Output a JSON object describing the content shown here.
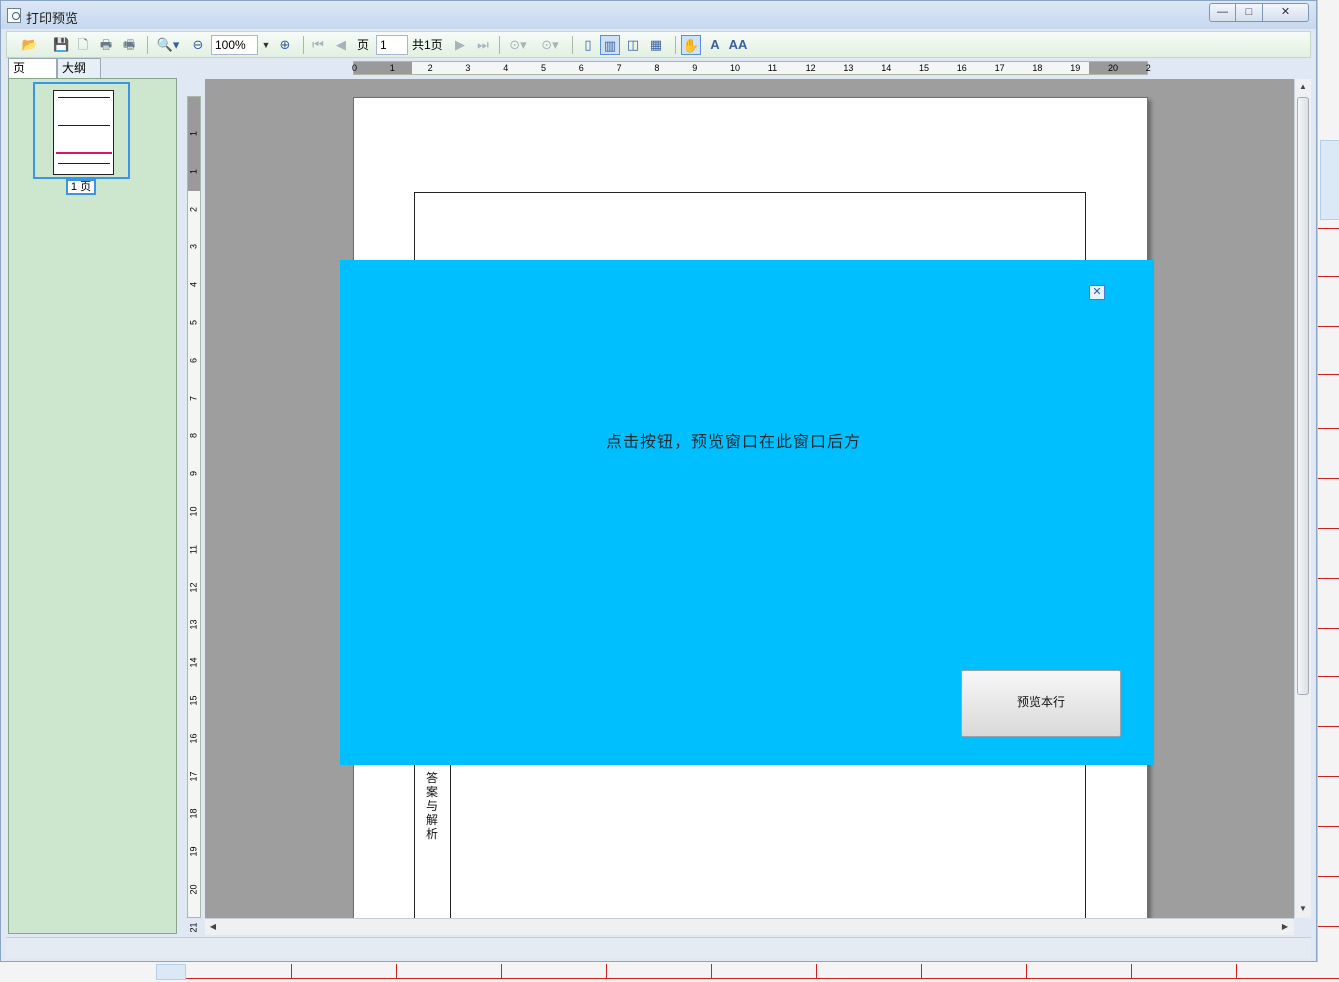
{
  "window": {
    "title": "打印预览",
    "buttons": {
      "minimize": "—",
      "maximize": "□",
      "close": "✕"
    }
  },
  "toolbar": {
    "zoom_value": "100%",
    "page_label": "页",
    "page_input": "1",
    "total_pages": "共1页",
    "icons": [
      "open-icon",
      "save-icon",
      "new-icon",
      "print-icon",
      "print-setup-icon",
      "zoom-in-icon",
      "zoom-out-icon",
      "zoom-plus-icon",
      "first-page-icon",
      "prev-page-icon",
      "next-page-icon",
      "last-page-icon",
      "back-icon",
      "forward-icon",
      "single-page-icon",
      "continuous-icon",
      "facing-icon",
      "multi-page-icon",
      "hand-tool-icon",
      "text-select-icon",
      "find-icon"
    ]
  },
  "sidebar": {
    "tabs": [
      "页",
      "大纲"
    ],
    "thumbnail_label": "1 页"
  },
  "ruler": {
    "horizontal": [
      "0",
      "1",
      "2",
      "3",
      "4",
      "5",
      "6",
      "7",
      "8",
      "9",
      "10",
      "11",
      "12",
      "13",
      "14",
      "15",
      "16",
      "17",
      "18",
      "19",
      "20",
      "2"
    ],
    "vertical": [
      "1",
      "1",
      "2",
      "3",
      "4",
      "5",
      "6",
      "7",
      "8",
      "9",
      "10",
      "11",
      "12",
      "13",
      "14",
      "15",
      "16",
      "17",
      "18",
      "19",
      "20",
      "21"
    ]
  },
  "document": {
    "answer_label": "答案与解析"
  },
  "popup": {
    "message": "点击按钮，预览窗口在此窗口后方",
    "button_label": "预览本行",
    "close_glyph": "✕",
    "background": "#00bfff"
  }
}
